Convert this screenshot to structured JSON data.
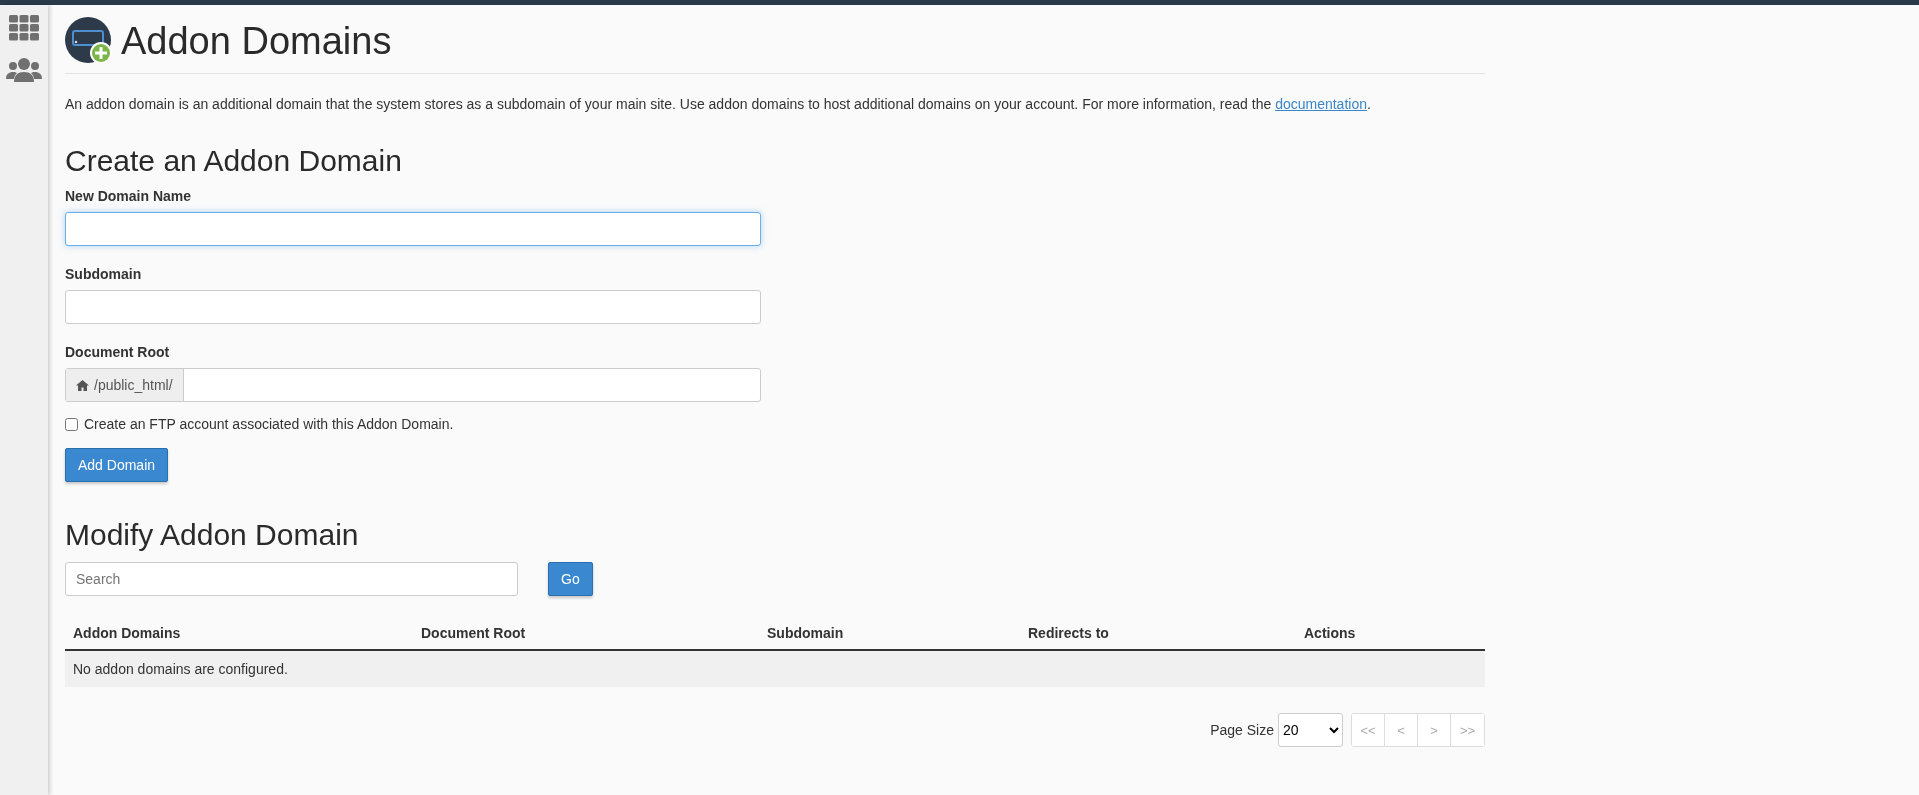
{
  "title": "Addon Domains",
  "description": {
    "text": "An addon domain is an additional domain that the system stores as a subdomain of your main site. Use addon domains to host additional domains on your account. For more information, read the ",
    "link": "documentation",
    "after": "."
  },
  "create": {
    "heading": "Create an Addon Domain",
    "fields": [
      {
        "label": "New Domain Name",
        "kind": "text",
        "focused": true
      },
      {
        "label": "Subdomain",
        "kind": "text",
        "focused": false
      },
      {
        "label": "Document Root",
        "kind": "path",
        "prefix": "/public_html/",
        "focused": false
      }
    ],
    "ftp_checkbox": {
      "label": "Create an FTP account associated with this Addon Domain.",
      "checked": false
    },
    "submit": "Add Domain"
  },
  "modify": {
    "heading": "Modify Addon Domain",
    "search": {
      "placeholder": "Search"
    },
    "go": "Go",
    "table": {
      "columns": [
        "Addon Domains",
        "Document Root",
        "Subdomain",
        "Redirects to",
        "Actions"
      ],
      "empty_message": "No addon domains are configured."
    },
    "pagination": {
      "page_size_label": "Page Size",
      "page_size": "20",
      "buttons": [
        {
          "label": "<<",
          "disabled": true
        },
        {
          "label": "<",
          "disabled": true
        },
        {
          "label": ">",
          "disabled": true
        },
        {
          "label": ">>",
          "disabled": true
        }
      ]
    }
  }
}
